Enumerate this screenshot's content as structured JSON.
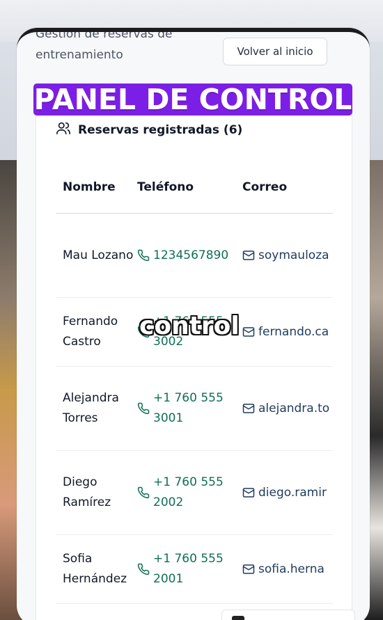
{
  "header": {
    "subtitle_line1": "Gestión de reservas de",
    "subtitle_line2": "entrenamiento",
    "back_button": "Volver al inicio"
  },
  "overlay": {
    "banner": "PANEL DE CONTROL",
    "caption": "control"
  },
  "card": {
    "title": "Reservas registradas (6)"
  },
  "table": {
    "headers": [
      "Nombre",
      "Teléfono",
      "Correo"
    ],
    "rows": [
      {
        "name": "Mau Lozano",
        "phone": "1234567890",
        "email": "soymauloza"
      },
      {
        "name": "Fernando Castro",
        "phone": "+1 760 555 3002",
        "email": "fernando.ca"
      },
      {
        "name": "Alejandra Torres",
        "phone": "+1 760 555 3001",
        "email": "alejandra.to"
      },
      {
        "name": "Diego Ramírez",
        "phone": "+1 760 555 2002",
        "email": "diego.ramir"
      },
      {
        "name": "Sofia Hernández",
        "phone": "+1 760 555 2001",
        "email": "sofia.herna"
      }
    ]
  },
  "colors": {
    "banner": "#7c1fe6",
    "phone_text": "#0f6e57",
    "email_text": "#1e3a5f"
  }
}
